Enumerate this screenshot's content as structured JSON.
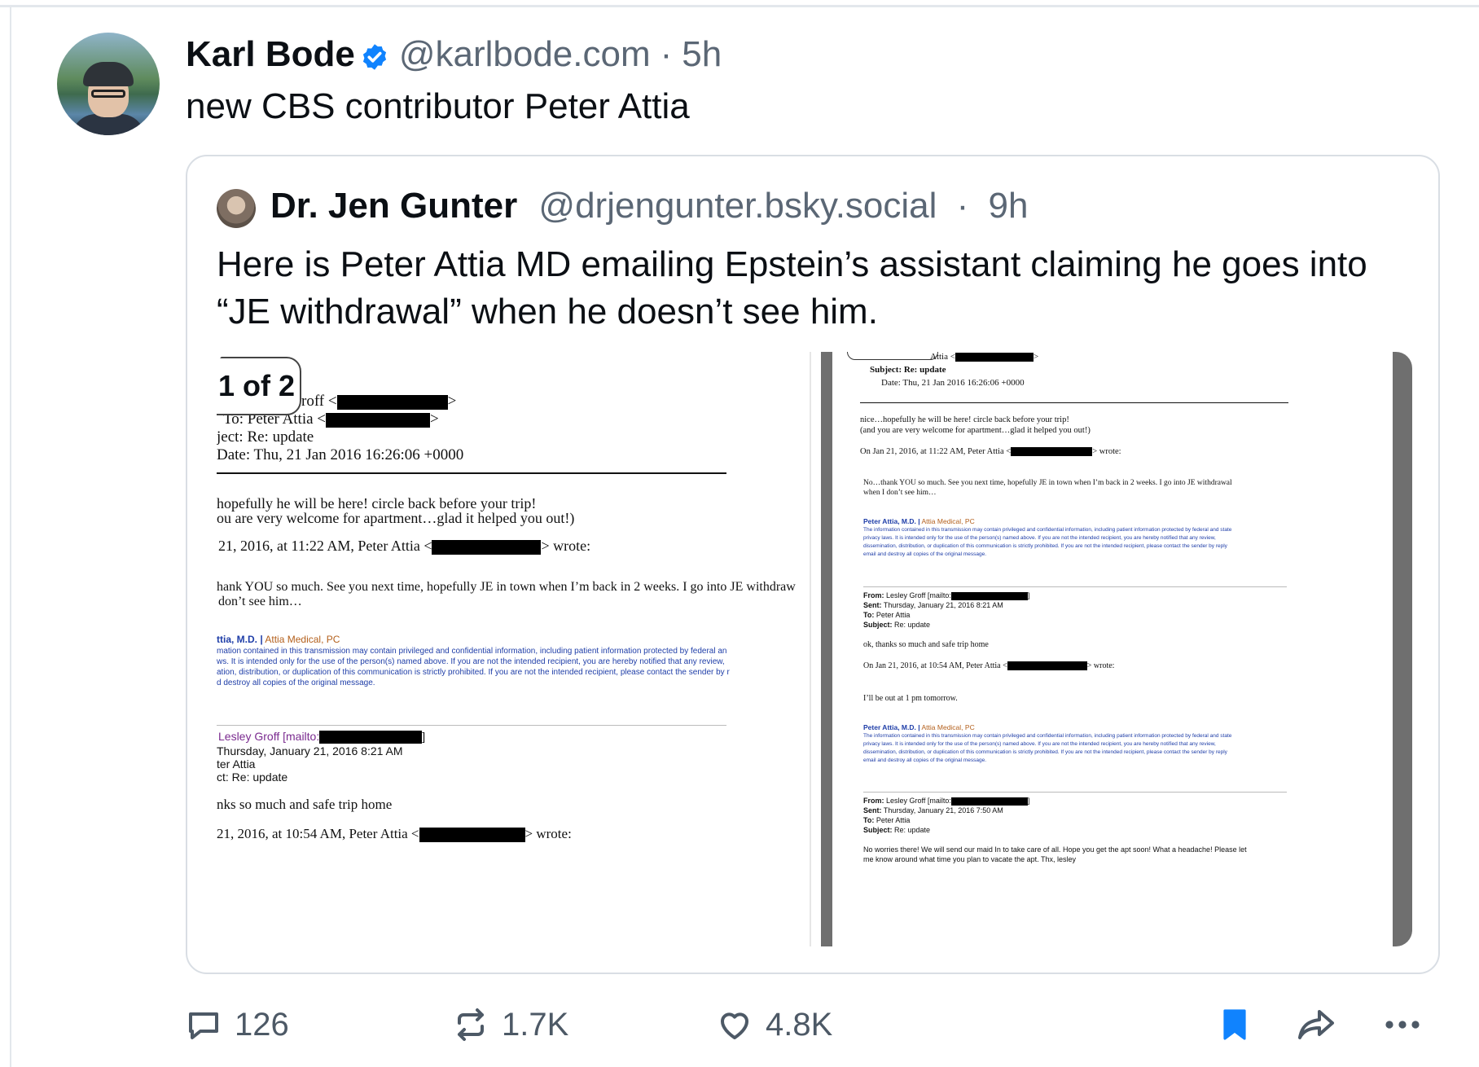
{
  "post": {
    "author_name": "Karl Bode",
    "handle": "@karlbode.com",
    "separator": "·",
    "time": "5h",
    "text": "new CBS contributor Peter Attia"
  },
  "quote": {
    "author_name": "Dr. Jen Gunter",
    "handle": "@drjengunter.bsky.social",
    "separator": "·",
    "time": "9h",
    "text": "Here is Peter Attia MD emailing Epstein’s assistant claiming he goes into “JE withdrawal” when he doesn’t see him.",
    "image_counter": "1 of 2"
  },
  "doc_left": {
    "from_partial": "roff",
    "to_line": "To: Peter Attia",
    "subject_partial": "ject: Re: update",
    "date_partial": "Date: Thu, 21 Jan 2016 16:26:06 +0000",
    "body1": "hopefully he will be here!  circle back before your trip!",
    "body2": "ou are very welcome for apartment…glad it helped you out!)",
    "wrote1_pre": "21, 2016, at 11:22 AM, Peter Attia <",
    "wrote_suffix": "> wrote:",
    "body3": "hank YOU so much. See you next time, hopefully JE in town when I’m back in 2 weeks. I go into JE withdraw",
    "body4": "don’t see him…",
    "sig_name": "ttia, M.D. |",
    "sig_org": "Attia Medical, PC",
    "disc1": "mation contained in this transmission may contain privileged and confidential information, including patient information protected by federal an",
    "disc2": "ws. It is intended only for the use of the person(s) named above. If you are not the intended recipient, you are hereby notified that any review,",
    "disc3": "ation, distribution, or duplication of this communication is strictly prohibited. If you are not the intended recipient, please contact the sender by r",
    "disc4": "d destroy all copies of the original message.",
    "from2": "Lesley Groff [mailto:",
    "sent2": "Thursday, January 21, 2016 8:21 AM",
    "to2": "ter Attia",
    "subj2": "ct: Re: update",
    "body5": "nks so much and safe trip home",
    "wrote2_pre": "21, 2016, at 10:54 AM, Peter Attia <"
  },
  "doc_right": {
    "to_partial": "Attia <",
    "subject": "Subject: Re: update",
    "date": "Date: Thu, 21 Jan 2016 16:26:06 +0000",
    "body1": "nice…hopefully he will be here!  circle back before your trip!",
    "body2": "(and you are very welcome for apartment…glad it helped you out!)",
    "wrote1_pre": "On Jan 21, 2016, at 11:22 AM, Peter Attia <",
    "wrote_suffix": "> wrote:",
    "body3": "No…thank YOU so much. See you next time, hopefully JE in town when I’m back in 2 weeks. I go into JE withdrawal",
    "body4": "when I don’t see him…",
    "sig_name": "Peter Attia, M.D. |",
    "sig_org": "Attia Medical, PC",
    "disc1": "The information contained in this transmission may contain privileged and confidential information, including patient information protected by federal and state",
    "disc2": "privacy laws. It is intended only for the use of the person(s) named above. If you are not the intended recipient, you are hereby notified that any review,",
    "disc3": "dissemination, distribution, or duplication of this communication is strictly prohibited. If you are not the intended recipient, please contact the sender by reply",
    "disc4": "email and destroy all copies of the original message.",
    "from2_label": "From:",
    "from2": "Lesley Groff [mailto:",
    "sent2_label": "Sent:",
    "sent2": "Thursday, January 21, 2016 8:21 AM",
    "to2_label": "To:",
    "to2": "Peter Attia",
    "subj2_label": "Subject:",
    "subj2": "Re: update",
    "body5": "ok, thanks so much and safe trip home",
    "wrote2_pre": "On Jan 21, 2016, at 10:54 AM, Peter Attia <",
    "body6": "I’ll be out at 1 pm tomorrow.",
    "sent3": "Thursday, January 21, 2016 7:50 AM",
    "body7": "No worries there!  We will send our maid In to take care of all. Hope you get the apt soon!  What a headache!  Please let",
    "body8": "me know around what time you plan to vacate the apt.  Thx, lesley"
  },
  "actions": {
    "replies": "126",
    "reposts": "1.7K",
    "likes": "4.8K"
  },
  "colors": {
    "accent": "#1083fe",
    "muted_text": "#5b6775",
    "border": "#d9dee4"
  },
  "icons": [
    "verified-badge-icon",
    "reply-icon",
    "repost-icon",
    "like-icon",
    "bookmark-icon",
    "share-icon",
    "more-icon"
  ]
}
